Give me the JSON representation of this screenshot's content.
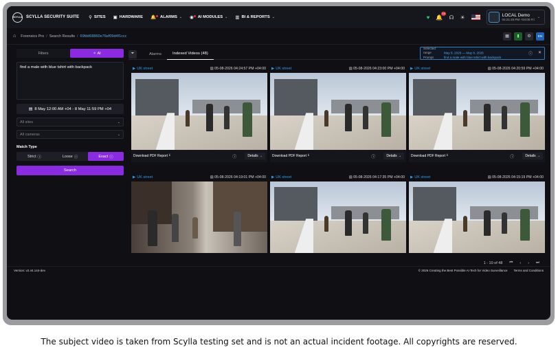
{
  "app": {
    "name": "SCYLLA SECURITY SUITE",
    "logo_text": "SCYLLA"
  },
  "nav": [
    {
      "label": "SITES",
      "icon": "location-pin-icon",
      "has_chevron": false
    },
    {
      "label": "HARDWARE",
      "icon": "car-icon",
      "has_chevron": false
    },
    {
      "label": "ALARMS",
      "icon": "bell-icon",
      "has_chevron": true
    },
    {
      "label": "AI MODULES",
      "icon": "ai-brain-icon",
      "has_chevron": true
    },
    {
      "label": "BI & REPORTS",
      "icon": "bar-chart-icon",
      "has_chevron": true
    }
  ],
  "topbar": {
    "notifications_count": "14",
    "user_name": "LOCAL Demo",
    "user_time": "04:21:49 PM +04:00 Fri"
  },
  "breadcrumb": {
    "items": [
      "Forensics Pro",
      "Search Results"
    ],
    "current": "69fdd68860e76ef09d4f1ccc",
    "action_label": "EN"
  },
  "sidebar": {
    "filters_tab": "Filters",
    "ai_tab": "AI",
    "query": "find a male with blue tshirt with backpack",
    "date_range": "8 May 12:00 AM +04 - 8 May 11:59 PM +04",
    "sites_placeholder": "All sites",
    "cameras_placeholder": "All cameras",
    "match_type_label": "Match Type",
    "match_options": [
      "Strict",
      "Loose",
      "Exact"
    ],
    "match_selected": "Exact",
    "search_label": "Search"
  },
  "main": {
    "tabs": [
      "Alarms",
      "Indexed Videos (48)"
    ],
    "active_tab": "Indexed Videos (48)",
    "info": {
      "range_key": "Selected range",
      "range_val": "May 8, 2026 — May 8, 2026",
      "prompt_key": "Prompt",
      "prompt_val": "find a male with blue tshirt with backpack"
    },
    "cards": [
      {
        "camera": "UK street",
        "time": "05-08-2026 04:24:57 PM +04:00",
        "pdf": "Download PDF Report",
        "details": "Details",
        "scene": "bridge"
      },
      {
        "camera": "UK street",
        "time": "05-08-2026 04:23:00 PM +04:00",
        "pdf": "Download PDF Report",
        "details": "Details",
        "scene": "bridge"
      },
      {
        "camera": "UK street",
        "time": "05-08-2026 04:20:59 PM +04:00",
        "pdf": "Download PDF Report",
        "details": "Details",
        "scene": "bridge"
      },
      {
        "camera": "UK street",
        "time": "05-08-2026 04:19:01 PM +04:00",
        "pdf": "",
        "details": "",
        "scene": "street"
      },
      {
        "camera": "UK street",
        "time": "05-08-2026 04:17:35 PM +04:00",
        "pdf": "",
        "details": "",
        "scene": "bridge"
      },
      {
        "camera": "UK street",
        "time": "05-08-2026 04:15:19 PM +04:00",
        "pdf": "",
        "details": "",
        "scene": "bridge"
      }
    ],
    "pagination": "1 - 10 of 48"
  },
  "footer": {
    "version": "Version: v2.44.144-dev",
    "copyright": "© 2026 Creating the Best Possible AI Tech for Video Surveillance",
    "terms": "Terms and Conditions"
  },
  "caption": "The subject video is taken from Scylla testing set and is not an actual incident footage. All copyrights are reserved.",
  "colors": {
    "accent": "#8a2be2",
    "link": "#2e9be6",
    "background": "#0f0f14"
  }
}
